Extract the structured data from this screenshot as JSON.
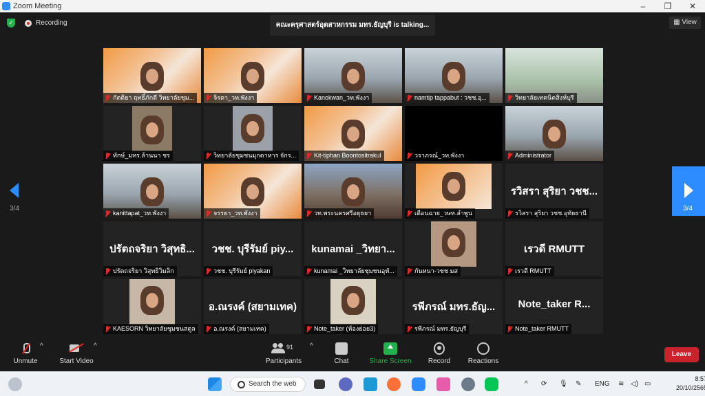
{
  "window": {
    "title": "Zoom Meeting",
    "minimize": "–",
    "maximize": "❐",
    "close": "✕"
  },
  "top": {
    "recording": "Recording",
    "talking": "คณะครุศาสตร์อุตสาหกรรม มทร.ธัญบุรี is  talking...",
    "view": "View"
  },
  "nav": {
    "left_page": "3/4",
    "right_page": "3/4"
  },
  "tiles": [
    {
      "name": "กัตติยา ฤทธิ์ภักดี วิทยาลัยชุม...",
      "big": ""
    },
    {
      "name": "จิรดา_วท.พังงา",
      "big": ""
    },
    {
      "name": "Kanokwan_วท.พังงา",
      "big": ""
    },
    {
      "name": "namtip tappabut : วชช.อุ...",
      "big": ""
    },
    {
      "name": "วิทยาลัยเทคนิคสิงห์บุรี",
      "big": ""
    },
    {
      "name": "ทักษ์_มทร.ล้านนา ชร",
      "big": ""
    },
    {
      "name": "วิทยาลัยชุมชนมุกดาหาร จักร...",
      "big": ""
    },
    {
      "name": "Kit-tiphan Boontositrakul",
      "big": ""
    },
    {
      "name": "วราภรณ์_วท.พังงา",
      "big": ""
    },
    {
      "name": "Administrator",
      "big": ""
    },
    {
      "name": "kanittapat_วท.พังงา",
      "big": ""
    },
    {
      "name": "จรรยา_วท.พังงา",
      "big": ""
    },
    {
      "name": "วท.พระนครศรีอยุธยา",
      "big": ""
    },
    {
      "name": "เดือนฉาย_วษท.ลำพูน",
      "big": ""
    },
    {
      "name": "รวิสรา สุริยา วชช.อุทัยธานี",
      "big": "รวิสรา สุริยา วชช..."
    },
    {
      "name": "ปรัตถจริยา วิสุทธิวิมลิก",
      "big": "ปรัตถจริยา วิสุทธิ..."
    },
    {
      "name": "วชช. บุรีรัมย์ piyakan",
      "big": "วชช. บุรีรัมย์ piy..."
    },
    {
      "name": "kunamai _วิทยาลัยชุมชนอุทั...",
      "big": "kunamai _วิทยา..."
    },
    {
      "name": "กันหนา-วชช มส",
      "big": ""
    },
    {
      "name": "เรวดี RMUTT",
      "big": "เรวดี RMUTT"
    },
    {
      "name": "KAESORN วิทยาลัยชุมชนสตูล",
      "big": ""
    },
    {
      "name": "อ.ณรงค์ (สยามเทค)",
      "big": "อ.ณรงค์ (สยามเทค)"
    },
    {
      "name": "Note_taker (ห้องย่อย3)",
      "big": ""
    },
    {
      "name": "รพีภรณ์ มทร.ธัญบุรี",
      "big": "รพีภรณ์ มทร.ธัญ..."
    },
    {
      "name": "Note_taker    RMUTT",
      "big": "Note_taker    R..."
    }
  ],
  "toolbar": {
    "unmute": "Unmute",
    "start_video": "Start Video",
    "participants": "Participants",
    "participants_count": "91",
    "chat": "Chat",
    "share_screen": "Share Screen",
    "record": "Record",
    "reactions": "Reactions",
    "leave": "Leave",
    "caret": "^"
  },
  "taskbar": {
    "search": "Search the web",
    "lang": "ENG",
    "time": "8:57",
    "date": "20/10/2565"
  },
  "colors": {
    "zoom_blue": "#2d8cff",
    "share_green": "#23b14d",
    "leave_red": "#c9232b",
    "muted_red": "#e02828"
  }
}
